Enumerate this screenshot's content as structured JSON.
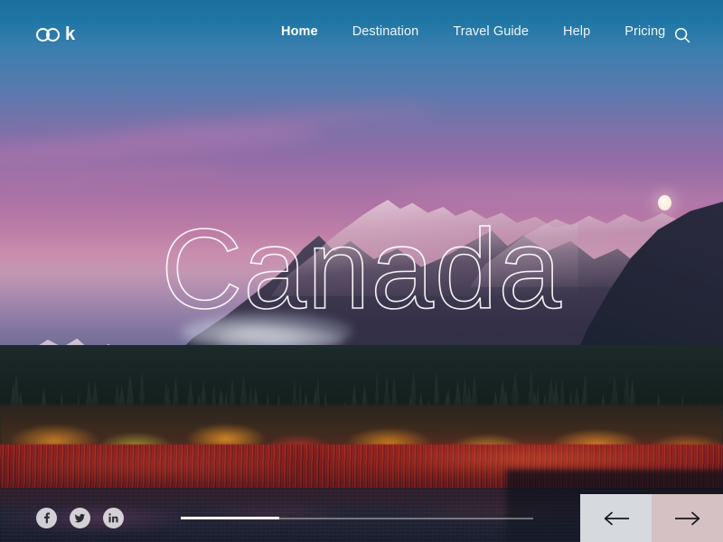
{
  "brand": {
    "name": "ook",
    "mark_letter": "k",
    "icon": "double-ring-logo-icon"
  },
  "nav": {
    "items": [
      {
        "label": "Home",
        "active": true
      },
      {
        "label": "Destination",
        "active": false
      },
      {
        "label": "Travel Guide",
        "active": false
      },
      {
        "label": "Help",
        "active": false
      },
      {
        "label": "Pricing",
        "active": false
      }
    ],
    "search_icon": "search-icon"
  },
  "hero": {
    "title": "Canada",
    "scene_description": "Snow-capped mountain range at dusk with autumn forest reflected in a still lake",
    "sky_top_color": "#1b6e9e",
    "sky_bottom_color": "#c98ead"
  },
  "social": {
    "items": [
      {
        "name": "facebook",
        "glyph": "f"
      },
      {
        "name": "twitter",
        "glyph": "t"
      },
      {
        "name": "linkedin",
        "glyph": "in"
      }
    ]
  },
  "slider": {
    "progress_percent": 28,
    "track_color": "#ffffff",
    "prev_label": "←",
    "next_label": "→",
    "prev_bg": "#d6d9dd",
    "next_bg": "#d5c0c3"
  }
}
